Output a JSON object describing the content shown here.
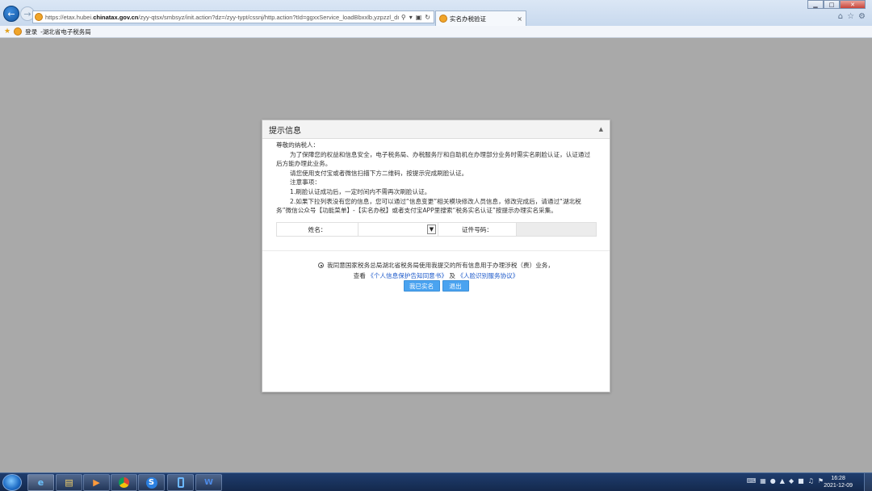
{
  "browser": {
    "url_prefix": "https://etax.hubei.",
    "url_domain": "chinatax.gov.cn",
    "url_rest": "/zyy-qtsx/smbsyz/init.action?dz=/zyy-typt/cssnj/http.action?tId=ggxxService_loadBbxxlb,yzpzzl_dm=BS'",
    "tab_title": "实名办税验证",
    "tab_close": "×",
    "win_min": "▁",
    "win_max": "□",
    "win_close": "✕",
    "tool_icons": [
      "home-icon",
      "star-icon",
      "gear-icon"
    ]
  },
  "favbar": {
    "login": "登录",
    "site": "-湖北省电子税务局"
  },
  "dialog": {
    "title": "提示信息",
    "collapse": "▲",
    "greeting": "尊敬的纳税人：",
    "para1": "为了保障您的权益和信息安全，电子税务局、办税服务厅和自助机在办理部分业务时需实名刷脸认证，认证通过后方能办理此业务。",
    "para2": "请您使用支付宝或者微信扫描下方二维码，按提示完成刷脸认证。",
    "notes_title": "注意事项：",
    "note1": "1.刷脸认证成功后，一定时间内不需再次刷脸认证。",
    "note2": "2.如果下拉列表没有您的信息，您可以通过“信息变更”相关模块修改人员信息，修改完成后，请通过“湖北税务”微信公众号【功能菜单】-【实名办税】或者支付宝APP里搜索“税务实名认证”按提示办理实名采集。",
    "form": {
      "name_label": "姓名：",
      "name_value": "",
      "id_label": "证件号码：",
      "id_value": ""
    },
    "agree_text": "我同意国家税务总局湖北省税务局使用我提交的所有信息用于办理涉税（费）业务，",
    "view_prefix": "查看",
    "link1": "《个人信息保护告知同意书》",
    "and": "及",
    "link2": "《人脸识别服务协议》",
    "btn_confirm": "我已实名",
    "btn_exit": "退出"
  },
  "taskbar": {
    "apps": [
      "ie-icon",
      "explorer-icon",
      "media-player-icon",
      "chrome-icon",
      "sogou-icon",
      "phone-icon",
      "word-icon"
    ],
    "time": "16:28",
    "date": "2021-12-09"
  },
  "colors": {
    "button_blue": "#4aa3f0",
    "link_blue": "#1a57c9",
    "overlay_gray": "#a9a9a9"
  }
}
